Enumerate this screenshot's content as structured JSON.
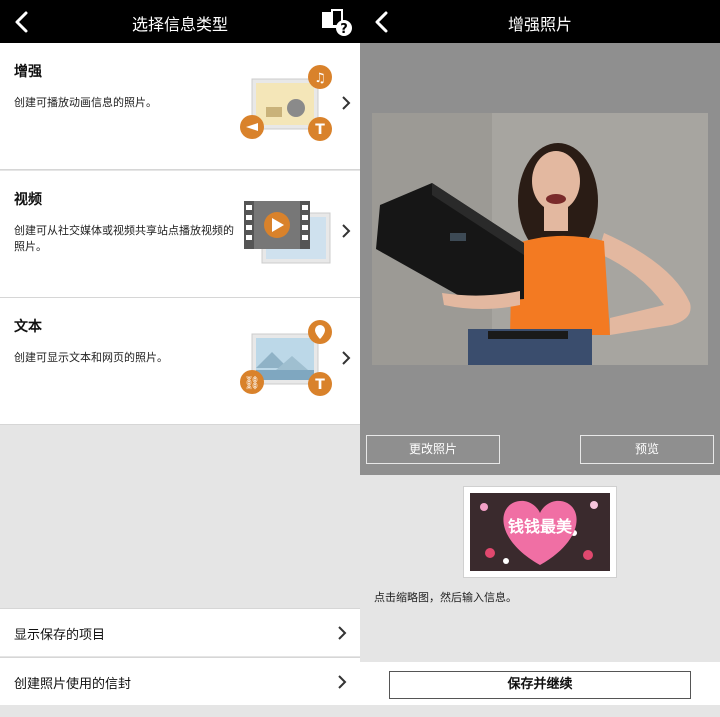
{
  "left": {
    "title": "选择信息类型",
    "items": [
      {
        "label": "增强",
        "desc": "创建可播放动画信息的照片。"
      },
      {
        "label": "视频",
        "desc": "创建可从社交媒体或视频共享站点播放视频的照片。"
      },
      {
        "label": "文本",
        "desc": "创建可显示文本和网页的照片。"
      }
    ],
    "bottom_items": [
      {
        "label": "显示保存的项目"
      },
      {
        "label": "创建照片使用的信封"
      }
    ]
  },
  "right": {
    "title": "增强照片",
    "change_photo_label": "更改照片",
    "preview_label": "预览",
    "thumbnail_text": "钱钱最美",
    "hint": "点击缩略图，然后输入信息。",
    "save_label": "保存并继续"
  },
  "colors": {
    "accent_orange": "#d9822b",
    "header_bg": "#000000",
    "stage_gray": "#8f8f8f"
  },
  "icons": [
    "back-icon",
    "help-icon",
    "chevron-right-icon",
    "music-icon",
    "text-icon",
    "link-icon",
    "location-icon",
    "play-icon"
  ]
}
